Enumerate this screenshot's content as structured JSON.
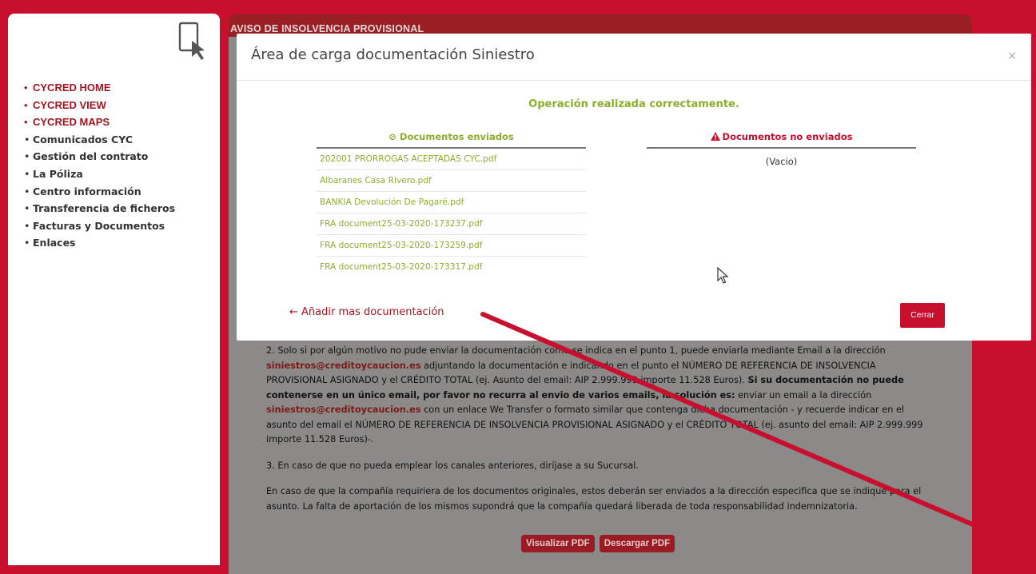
{
  "sidebar": {
    "items": [
      {
        "label": "CYCRED HOME",
        "highlight": true
      },
      {
        "label": "CYCRED VIEW",
        "highlight": true
      },
      {
        "label": "CYCRED MAPS",
        "highlight": true
      },
      {
        "label": "Comunicados CYC",
        "highlight": false
      },
      {
        "label": "Gestión del contrato",
        "highlight": false
      },
      {
        "label": "La Póliza",
        "highlight": false
      },
      {
        "label": "Centro información",
        "highlight": false
      },
      {
        "label": "Transferencia de ficheros",
        "highlight": false
      },
      {
        "label": "Facturas y Documentos",
        "highlight": false
      },
      {
        "label": "Enlaces",
        "highlight": false
      }
    ]
  },
  "panel": {
    "title": "AVISO DE INSOLVENCIA PROVISIONAL",
    "p2_a": "2. Solo si por algún motivo no pude enviar la documentación como se indica en el punto 1, puede enviarla mediante Email a la dirección",
    "email": "siniestros@creditoycaucion.es",
    "p2_b": "adjuntando la documentación e indicando en el punto el NÚMERO DE REFERENCIA DE INSOLVENCIA PROVISIONAL ASIGNADO y el CRÉDITO TOTAL (ej. Asunto del email: AIP 2.999.999 importe 11.528 Euros).",
    "p2_bold": "Si su documentación no puede contenerse en un único email, por favor no recurra al envio de varios emails, la solución es:",
    "p2_c": "enviar un email a la dirección",
    "p2_d": "con un enlace We Transfer o formato similar que contenga dicha documentación - y recuerde indicar en el asunto del email el NÚMERO DE REFERENCIA DE INSOLVENCIA PROVISIONAL ASIGNADO y el CRÉDITO TOTAL (ej. asunto del email: AIP 2.999.999 importe 11.528 Euros)-.",
    "p3": "3. En caso de que no pueda emplear los canales anteriores, diríjase a su Sucursal.",
    "p4": "En caso de que la compañía requiriera de los documentos originales, estos deberán ser enviados a la dirección especifica que se indique para el asunto. La falta de aportación de los mismos supondrá que la compañía quedará liberada de toda responsabilidad indemnizatoria.",
    "btn_view": "Visualizar PDF",
    "btn_download": "Descargar PDF"
  },
  "modal": {
    "title": "Área de carga documentación Siniestro",
    "close": "×",
    "success": "Operación realizada correctamente.",
    "sent_header": "⊘ Documentos enviados",
    "notsent_header": "Documentos no enviados",
    "sent_files": [
      "202001 PRÓRROGAS ACEPTADAS CYC.pdf",
      "Albaranes Casa Rivero.pdf",
      "BANKIA Devolución De Pagaré.pdf",
      "FRA document25-03-2020-173237.pdf",
      "FRA document25-03-2020-173259.pdf",
      "FRA document25-03-2020-173317.pdf"
    ],
    "notsent_empty": "(Vacio)",
    "add_more": "← Añadir mas documentación",
    "close_button": "Cerrar"
  },
  "colors": {
    "brand_red": "#c8102e",
    "success_green": "#8cae2c"
  }
}
